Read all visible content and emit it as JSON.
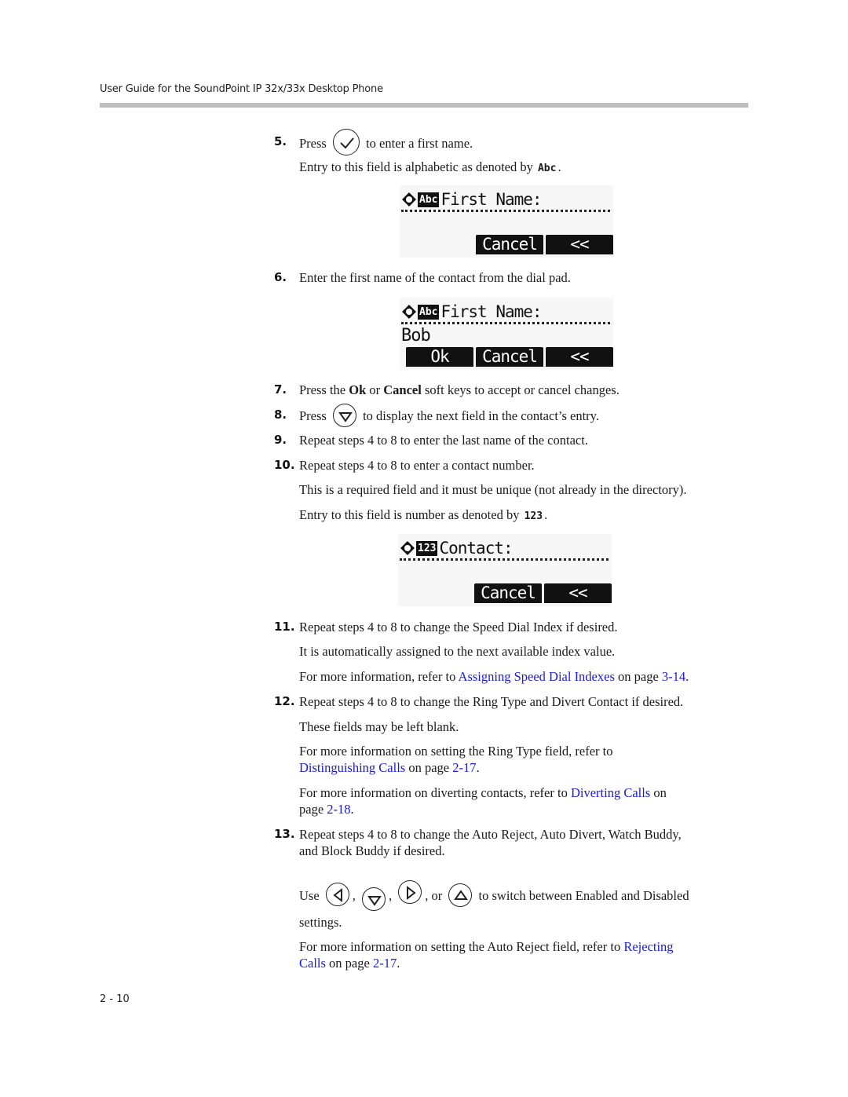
{
  "header": {
    "title": "User Guide for the SoundPoint IP 32x/33x Desktop Phone"
  },
  "footer": {
    "page_number": "2 - 10"
  },
  "icons": {
    "select": "check-circle",
    "down": "down-arrow-circle",
    "left": "left-arrow-circle",
    "right": "right-arrow-circle",
    "up": "up-arrow-circle"
  },
  "steps": {
    "s5": {
      "num": "5.",
      "pre": "Press",
      "post": "to enter a first name.",
      "note_pre": "Entry to this field is alphabetic as denoted by",
      "note_glyph": "Abc",
      "note_post": "."
    },
    "s6": {
      "num": "6.",
      "text": "Enter the first name of the contact from the dial pad."
    },
    "s7": {
      "num": "7.",
      "t1": "Press the ",
      "b1": "Ok",
      "t2": " or ",
      "b2": "Cancel",
      "t3": " soft keys to accept or cancel changes."
    },
    "s8": {
      "num": "8.",
      "pre": "Press",
      "post": "to display the next field in the contact’s entry."
    },
    "s9": {
      "num": "9.",
      "text": "Repeat steps 4 to 8 to enter the last name of the contact."
    },
    "s10": {
      "num": "10.",
      "text": "Repeat steps 4 to 8 to enter a contact number.",
      "p1": "This is a required field and it must be unique (not already in the directory).",
      "note_pre": "Entry to this field is number as denoted by",
      "note_glyph": "123",
      "note_post": "."
    },
    "s11": {
      "num": "11.",
      "text": "Repeat steps 4 to 8 to change the Speed Dial Index if desired.",
      "p1": "It is automatically assigned to the next available index value.",
      "p2_pre": "For more information, refer to ",
      "p2_link": "Assigning Speed Dial Indexes",
      "p2_mid": " on page ",
      "p2_page": "3-14",
      "p2_post": "."
    },
    "s12": {
      "num": "12.",
      "text": "Repeat steps 4 to 8 to change the Ring Type and Divert Contact if desired.",
      "p1": "These fields may be left blank.",
      "p2_pre": "For more information on setting the Ring Type field, refer to",
      "p2_link": "Distinguishing Calls",
      "p2_mid": " on page ",
      "p2_page": "2-17",
      "p2_post": ".",
      "p3_pre": "For more information on diverting contacts, refer to ",
      "p3_link": "Diverting Calls",
      "p3_mid": " on",
      "p3_mid2": "page ",
      "p3_page": "2-18",
      "p3_post": "."
    },
    "s13": {
      "num": "13.",
      "text1": "Repeat steps 4 to 8 to change the Auto Reject, Auto Divert, Watch Buddy,",
      "text2": "and Block Buddy if desired.",
      "use": "Use",
      "comma": ",",
      "or": ", or",
      "use_post": "to switch between Enabled and Disabled",
      "settings": "settings.",
      "p_pre": "For more information on setting the Auto Reject field, refer to ",
      "p_link1": "Rejecting",
      "p_link2": "Calls",
      "p_mid": " on page ",
      "p_page": "2-17",
      "p_post": "."
    }
  },
  "screens": {
    "first_name_empty": {
      "mode": "Abc",
      "title": "First Name:",
      "value": "",
      "softkeys": [
        "Cancel",
        "<<"
      ]
    },
    "first_name_bob": {
      "mode": "Abc",
      "title": "First Name:",
      "value": "Bob",
      "softkeys": [
        "Ok",
        "Cancel",
        "<<"
      ]
    },
    "contact_empty": {
      "mode": "123",
      "title": "Contact:",
      "value": "",
      "softkeys": [
        "Cancel",
        "<<"
      ]
    }
  }
}
